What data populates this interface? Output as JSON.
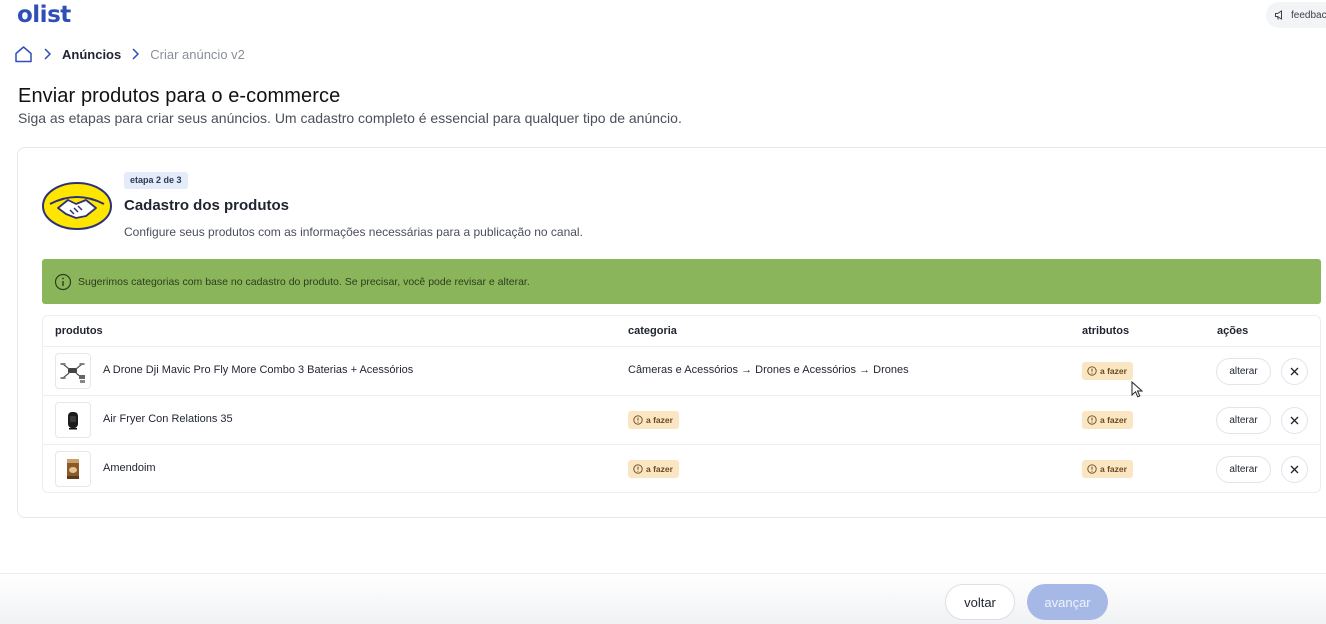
{
  "app": {
    "logo_text": "olist",
    "feedback_label": "feedback",
    "brand_color": "#2f4fb8"
  },
  "breadcrumb": {
    "link": "Anúncios",
    "current": "Criar anúncio v2"
  },
  "page": {
    "title": "Enviar produtos para o e-commerce",
    "subtitle": "Siga as etapas para criar seus anúncios. Um cadastro completo é essencial para qualquer tipo de anúncio."
  },
  "step": {
    "badge": "etapa 2 de 3",
    "title": "Cadastro dos produtos",
    "description": "Configure seus produtos com as informações necessárias para a publicação no canal.",
    "channel_icon": "mercado-livre-handshake-icon"
  },
  "banner": {
    "text": "Sugerimos categorias com base no cadastro do produto. Se precisar, você pode revisar e alterar.",
    "color": "#8ab55a"
  },
  "table": {
    "headers": {
      "produtos": "produtos",
      "categoria": "categoria",
      "atributos": "atributos",
      "acoes": "ações"
    },
    "rows": [
      {
        "name": "A Drone Dji Mavic Pro Fly More Combo 3 Baterias + Acessórios",
        "thumb_icon": "drone-kit-icon",
        "category": "Câmeras e Acessórios → Drones e Acessórios → Drones",
        "category_status": "",
        "attributes_status": "a fazer",
        "action_label": "alterar"
      },
      {
        "name": "Air Fryer Con Relations 35",
        "thumb_icon": "air-fryer-icon",
        "category": "",
        "category_status": "a fazer",
        "attributes_status": "a fazer",
        "action_label": "alterar"
      },
      {
        "name": "Amendoim",
        "thumb_icon": "peanut-package-icon",
        "category": "",
        "category_status": "a fazer",
        "attributes_status": "a fazer",
        "action_label": "alterar"
      }
    ]
  },
  "footer": {
    "back_label": "voltar",
    "next_label": "avançar"
  }
}
